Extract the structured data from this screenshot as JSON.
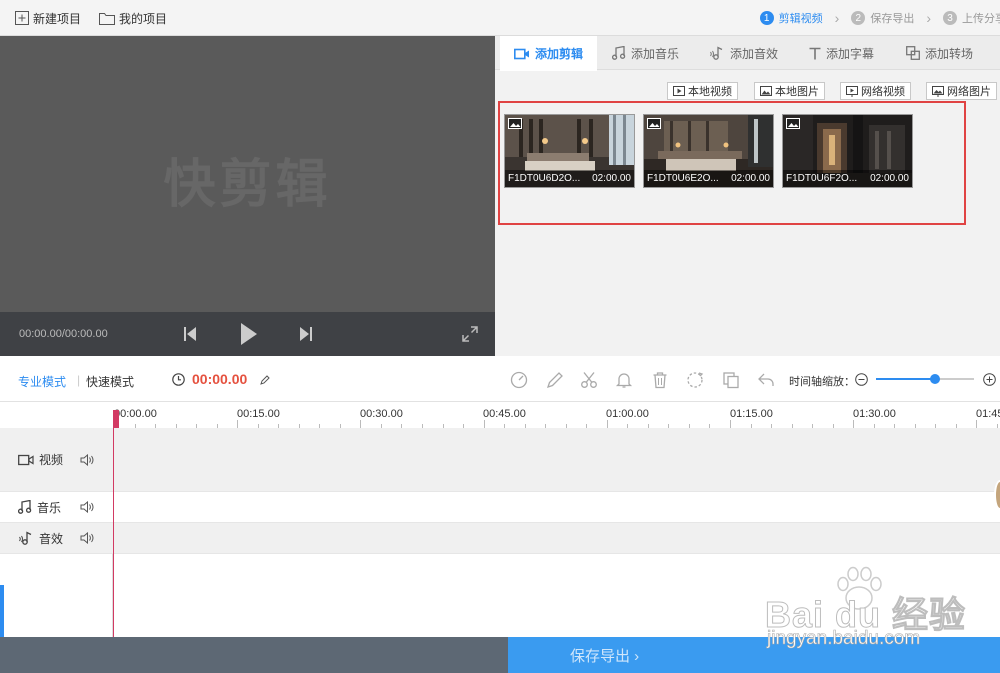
{
  "topbar": {
    "new_project": "新建项目",
    "my_projects": "我的项目",
    "steps": [
      {
        "num": "1",
        "label": "剪辑视频"
      },
      {
        "num": "2",
        "label": "保存导出"
      },
      {
        "num": "3",
        "label": "上传分享"
      }
    ]
  },
  "preview": {
    "logo": "快剪辑",
    "timecode": "00:00.00/00:00.00"
  },
  "media": {
    "tabs": [
      "添加剪辑",
      "添加音乐",
      "添加音效",
      "添加字幕",
      "添加转场"
    ],
    "sources": [
      "本地视频",
      "本地图片",
      "网络视频",
      "网络图片"
    ],
    "clips": [
      {
        "name": "F1DT0U6D2O...",
        "duration": "02:00.00"
      },
      {
        "name": "F1DT0U6E2O...",
        "duration": "02:00.00"
      },
      {
        "name": "F1DT0U6F2O...",
        "duration": "02:00.00"
      }
    ]
  },
  "timeline": {
    "mode_pro": "专业模式",
    "mode_fast": "快速模式",
    "current_time": "00:00.00",
    "zoom_label": "时间轴缩放：",
    "zoom_level": 0.6,
    "ruler": [
      "00:00.00",
      "00:15.00",
      "00:30.00",
      "00:45.00",
      "01:00.00",
      "01:15.00",
      "01:30.00",
      "01:45"
    ],
    "tracks": [
      "视频",
      "音乐",
      "音效"
    ]
  },
  "bottom": {
    "export": "保存导出 ›"
  },
  "watermark": {
    "brand": "Bai du 经验",
    "url": "jingyan.baidu.com"
  },
  "colors": {
    "accent": "#2d8cf0",
    "timecode": "#e5513f",
    "playhead": "#d23a63",
    "highlight": "#e04343"
  }
}
